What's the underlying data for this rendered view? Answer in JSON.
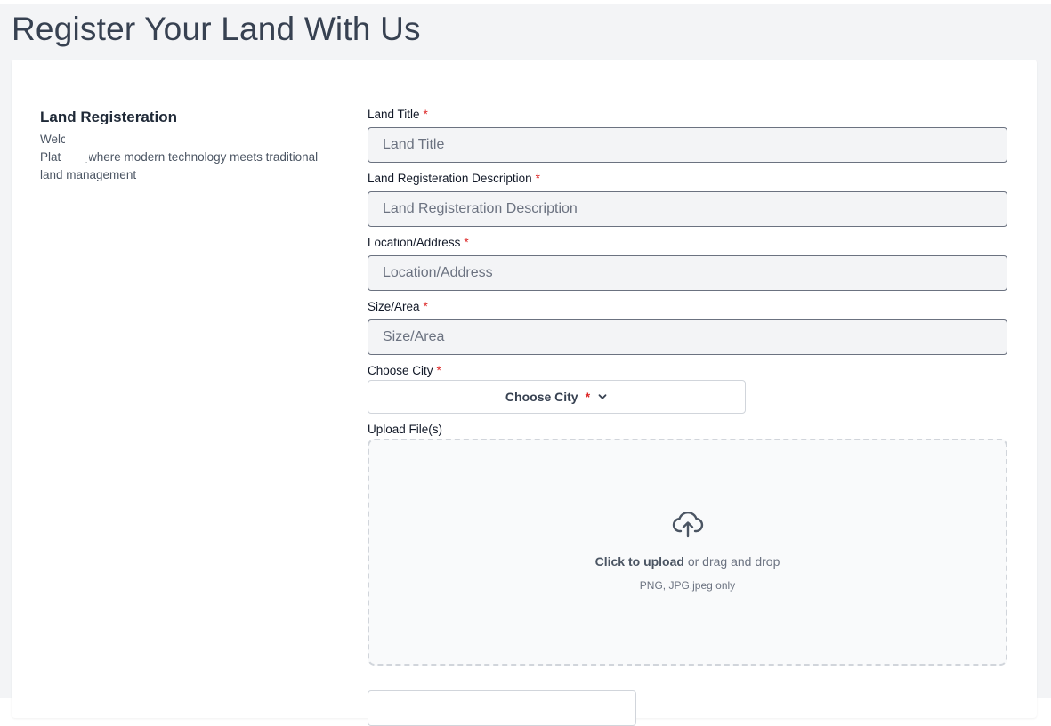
{
  "page": {
    "title": "Register Your Land With Us"
  },
  "intro": {
    "heading": "Land Registeration",
    "description": "Welcome to the cutting-edge Land Registry Platform,where modern technology meets traditional land management"
  },
  "form": {
    "land_title": {
      "label": "Land Title",
      "required_mark": "*",
      "placeholder": "Land Title",
      "value": ""
    },
    "description": {
      "label": "Land Registeration Description",
      "required_mark": "*",
      "placeholder": "Land Registeration Description",
      "value": ""
    },
    "location": {
      "label": "Location/Address",
      "required_mark": "*",
      "placeholder": "Location/Address",
      "value": ""
    },
    "size": {
      "label": "Size/Area",
      "required_mark": "*",
      "placeholder": "Size/Area",
      "value": ""
    },
    "city": {
      "label": "Choose City",
      "required_mark": "*",
      "button_label": "Choose City",
      "icon": "chevron-down-icon"
    },
    "upload": {
      "label": "Upload File(s)",
      "icon": "cloud-upload-icon",
      "click_text": "Click to upload",
      "drag_text": "or drag and drop",
      "hint": "PNG, JPG,jpeg only"
    }
  },
  "colors": {
    "page_background": "#f3f4f6",
    "input_background": "#f3f4f6",
    "required": "#dc2626",
    "border": "#6b7280"
  }
}
